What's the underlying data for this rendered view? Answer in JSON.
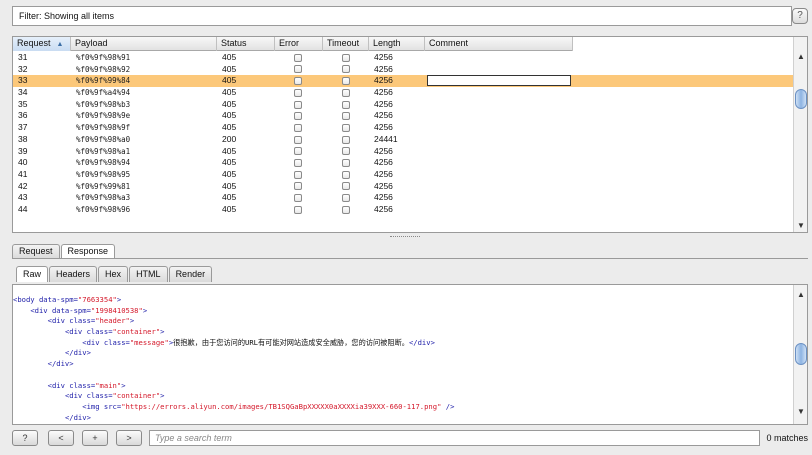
{
  "filter": {
    "label": "Filter: Showing all items",
    "help": "?"
  },
  "table": {
    "columns": [
      "Request",
      "Payload",
      "Status",
      "Error",
      "Timeout",
      "Length",
      "Comment"
    ],
    "sort_indicator": "▲",
    "selected_row": 2,
    "rows": [
      {
        "request": "31",
        "payload": "%f0%9f%98%91",
        "status": "405",
        "length": "4256"
      },
      {
        "request": "32",
        "payload": "%f0%9f%98%92",
        "status": "405",
        "length": "4256"
      },
      {
        "request": "33",
        "payload": "%f0%9f%99%84",
        "status": "405",
        "length": "4256"
      },
      {
        "request": "34",
        "payload": "%f0%9f%a4%94",
        "status": "405",
        "length": "4256"
      },
      {
        "request": "35",
        "payload": "%f0%9f%98%b3",
        "status": "405",
        "length": "4256"
      },
      {
        "request": "36",
        "payload": "%f0%9f%98%9e",
        "status": "405",
        "length": "4256"
      },
      {
        "request": "37",
        "payload": "%f0%9f%98%9f",
        "status": "405",
        "length": "4256"
      },
      {
        "request": "38",
        "payload": "%f0%9f%98%a0",
        "status": "200",
        "length": "24441"
      },
      {
        "request": "39",
        "payload": "%f0%9f%98%a1",
        "status": "405",
        "length": "4256"
      },
      {
        "request": "40",
        "payload": "%f0%9f%98%94",
        "status": "405",
        "length": "4256"
      },
      {
        "request": "41",
        "payload": "%f0%9f%98%95",
        "status": "405",
        "length": "4256"
      },
      {
        "request": "42",
        "payload": "%f0%9f%99%81",
        "status": "405",
        "length": "4256"
      },
      {
        "request": "43",
        "payload": "%f0%9f%98%a3",
        "status": "405",
        "length": "4256"
      },
      {
        "request": "44",
        "payload": "%f0%9f%98%96",
        "status": "405",
        "length": "4256"
      }
    ]
  },
  "tabs_top": [
    "Request",
    "Response"
  ],
  "tabs_top_active": 1,
  "tabs_sub": [
    "Raw",
    "Headers",
    "Hex",
    "HTML",
    "Render"
  ],
  "tabs_sub_active": 0,
  "code_lines": [
    [
      [
        "tag",
        "<body "
      ],
      [
        "attr",
        "data-spm="
      ],
      [
        "val",
        "\"7663354\""
      ],
      [
        "tag",
        ">"
      ]
    ],
    [
      [
        "txt",
        "    "
      ],
      [
        "tag",
        "<div "
      ],
      [
        "attr",
        "data-spm="
      ],
      [
        "val",
        "\"1998410538\""
      ],
      [
        "tag",
        ">"
      ]
    ],
    [
      [
        "txt",
        "        "
      ],
      [
        "tag",
        "<div "
      ],
      [
        "attr",
        "class="
      ],
      [
        "val",
        "\"header\""
      ],
      [
        "tag",
        ">"
      ]
    ],
    [
      [
        "txt",
        "            "
      ],
      [
        "tag",
        "<div "
      ],
      [
        "attr",
        "class="
      ],
      [
        "val",
        "\"container\""
      ],
      [
        "tag",
        ">"
      ]
    ],
    [
      [
        "txt",
        "                "
      ],
      [
        "tag",
        "<div "
      ],
      [
        "attr",
        "class="
      ],
      [
        "val",
        "\"message\""
      ],
      [
        "tag",
        ">"
      ],
      [
        "txt",
        "很抱歉，由于您访问的URL有可能对网站造成安全威胁，您的访问被阻断。"
      ],
      [
        "tag",
        "</div>"
      ]
    ],
    [
      [
        "txt",
        "            "
      ],
      [
        "tag",
        "</div>"
      ]
    ],
    [
      [
        "txt",
        "        "
      ],
      [
        "tag",
        "</div>"
      ]
    ],
    [
      [
        "txt",
        ""
      ]
    ],
    [
      [
        "txt",
        "        "
      ],
      [
        "tag",
        "<div "
      ],
      [
        "attr",
        "class="
      ],
      [
        "val",
        "\"main\""
      ],
      [
        "tag",
        ">"
      ]
    ],
    [
      [
        "txt",
        "            "
      ],
      [
        "tag",
        "<div "
      ],
      [
        "attr",
        "class="
      ],
      [
        "val",
        "\"container\""
      ],
      [
        "tag",
        ">"
      ]
    ],
    [
      [
        "txt",
        "                "
      ],
      [
        "tag",
        "<img "
      ],
      [
        "attr",
        "src="
      ],
      [
        "val",
        "\"https://errors.aliyun.com/images/TB1SQGaBpXXXXX0aXXXXia39XXX-660-117.png\""
      ],
      [
        "tag",
        " />"
      ]
    ],
    [
      [
        "txt",
        "            "
      ],
      [
        "tag",
        "</div>"
      ]
    ],
    [
      [
        "txt",
        "        "
      ],
      [
        "tag",
        "</div>"
      ]
    ]
  ],
  "bottom": {
    "help": "?",
    "prev": "<",
    "add": "+",
    "next": ">",
    "search_placeholder": "Type a search term",
    "matches": "0 matches"
  }
}
